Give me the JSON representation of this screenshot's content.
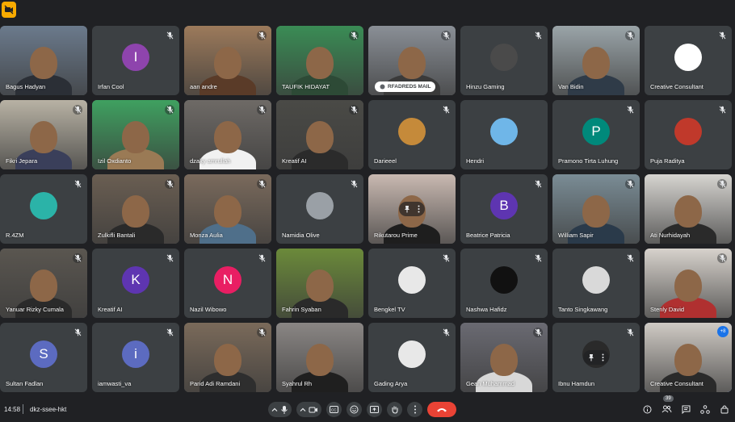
{
  "meeting": {
    "time": "14:58",
    "code": "dkz-ssee-hkt",
    "participant_count": "39"
  },
  "chips": {
    "mail": "RFADREDS MAIL",
    "self_badge": "+8"
  },
  "tiles": [
    {
      "name": "Bagus Hadyan",
      "kind": "video",
      "muted": false,
      "bg": "#6b7a8c",
      "body": "#2b2f36"
    },
    {
      "name": "Irfan Cool",
      "kind": "avatar",
      "letter": "I",
      "color": "#8e44ad",
      "muted": true
    },
    {
      "name": "aan andre",
      "kind": "video",
      "muted": true,
      "bg": "#9c7a5b",
      "body": "#5a3b28"
    },
    {
      "name": "TAUFIK HIDAYAT",
      "kind": "video",
      "muted": true,
      "bg": "#3a8c55",
      "body": "#2d4a36"
    },
    {
      "name": "RFADREDS MAIL",
      "kind": "video",
      "muted": true,
      "bg": "#8a8f96",
      "body": "#3a3a3a",
      "mail": true
    },
    {
      "name": "Hinzu Gaming",
      "kind": "photo",
      "color": "#4a4a4a",
      "muted": true
    },
    {
      "name": "Van Bidin",
      "kind": "video",
      "muted": true,
      "bg": "#9aa4a8",
      "body": "#2f3b48"
    },
    {
      "name": "Creative Consultant",
      "kind": "photo",
      "color": "#ffffff",
      "muted": true
    },
    {
      "name": "Fikri Jepara",
      "kind": "video",
      "muted": true,
      "bg": "#b8b2a4",
      "body": "#3a3f5a"
    },
    {
      "name": "Izil Oxdianto",
      "kind": "video",
      "muted": true,
      "bg": "#3fa060",
      "body": "#9a7a55"
    },
    {
      "name": "dzaky amrullah",
      "kind": "video",
      "muted": true,
      "bg": "#6e6a66",
      "body": "#f1f1f1"
    },
    {
      "name": "Kreatif AI",
      "kind": "video",
      "muted": true,
      "bg": "#4a4a46",
      "body": "#2b2b2b"
    },
    {
      "name": "Darieeel",
      "kind": "photo",
      "color": "#c58a3a",
      "muted": true
    },
    {
      "name": "Hendri",
      "kind": "photo",
      "color": "#6fb6e8",
      "muted": false
    },
    {
      "name": "Pramono Tirta Luhung",
      "kind": "avatar",
      "letter": "P",
      "color": "#00897b",
      "muted": true
    },
    {
      "name": "Puja Raditya",
      "kind": "photo",
      "color": "#c0392b",
      "muted": true
    },
    {
      "name": "R.4ZM",
      "kind": "photo",
      "color": "#2bb3a8",
      "muted": true
    },
    {
      "name": "Zulkifli Bantali",
      "kind": "video",
      "muted": true,
      "bg": "#6a5e52",
      "body": "#2a2a2a"
    },
    {
      "name": "Monza Aulia",
      "kind": "video",
      "muted": true,
      "bg": "#7a6a5c",
      "body": "#4f6f8a"
    },
    {
      "name": "Namidia Olive",
      "kind": "photo",
      "color": "#9aa0a6",
      "muted": true
    },
    {
      "name": "Rikutarou Prime",
      "kind": "video",
      "muted": false,
      "bg": "#c9b9b1",
      "body": "#1e1e1e",
      "pinbar": true
    },
    {
      "name": "Beatrice Patricia",
      "kind": "avatar",
      "letter": "B",
      "color": "#5e35b1",
      "muted": true
    },
    {
      "name": "William Sapir",
      "kind": "video",
      "muted": true,
      "bg": "#7a8c95",
      "body": "#2a3a4a"
    },
    {
      "name": "Ati Nurhidayah",
      "kind": "video",
      "muted": true,
      "bg": "#d6d4d0",
      "body": "#2a2a2a"
    },
    {
      "name": "Yanuar Rizky Cumala",
      "kind": "video",
      "muted": true,
      "bg": "#5a5650",
      "body": "#2a2a2a"
    },
    {
      "name": "Kreatif AI",
      "kind": "avatar",
      "letter": "K",
      "color": "#5e35b1",
      "muted": true
    },
    {
      "name": "Nazil Wibowo",
      "kind": "avatar",
      "letter": "N",
      "color": "#e91e63",
      "muted": true
    },
    {
      "name": "Fahrin Syaban",
      "kind": "video",
      "muted": false,
      "bg": "#6b8a3a",
      "body": "#2a2a2a"
    },
    {
      "name": "Bengkel TV",
      "kind": "photo",
      "color": "#e8e8e8",
      "muted": true
    },
    {
      "name": "Nashwa Hafidz",
      "kind": "photo",
      "color": "#111111",
      "muted": true
    },
    {
      "name": "Tanto Singkawang",
      "kind": "photo",
      "color": "#d9d9d9",
      "muted": true
    },
    {
      "name": "Stenly David",
      "kind": "video",
      "muted": true,
      "bg": "#d7d2cc",
      "body": "#b03030"
    },
    {
      "name": "Sultan Fadlan",
      "kind": "avatar",
      "letter": "S",
      "color": "#5c6bc0",
      "muted": true
    },
    {
      "name": "iamwasti_va",
      "kind": "avatar",
      "letter": "i",
      "color": "#5c6bc0",
      "muted": true
    },
    {
      "name": "Parid Adi Ramdani",
      "kind": "video",
      "muted": true,
      "bg": "#7a6a5a",
      "body": "#2e2e2e"
    },
    {
      "name": "Syahrul Rh",
      "kind": "video",
      "muted": false,
      "bg": "#8a8684",
      "body": "#1f1f1f"
    },
    {
      "name": "Gading Arya",
      "kind": "photo",
      "color": "#e8e8e8",
      "muted": true
    },
    {
      "name": "Gean Muhammad",
      "kind": "video",
      "muted": true,
      "bg": "#6a6a72",
      "body": "#d8d8d8"
    },
    {
      "name": "Ibnu Hamdun",
      "kind": "photo",
      "color": "#2a2a2a",
      "muted": true,
      "pinbar": true
    },
    {
      "name": "Creative Consultant",
      "kind": "video",
      "muted": false,
      "bg": "#cfcac4",
      "body": "#2a2a2a",
      "self": true
    }
  ],
  "icons": {
    "mic_muted": "mic-off-icon",
    "controls": [
      "chevron-up-icon",
      "mic-icon",
      "chevron-up-icon",
      "camera-icon",
      "captions-icon",
      "emoji-icon",
      "present-icon",
      "raise-hand-icon",
      "more-options-icon",
      "end-call-icon"
    ],
    "right": [
      "info-icon",
      "people-icon",
      "chat-icon",
      "activities-icon",
      "lock-icon"
    ]
  }
}
